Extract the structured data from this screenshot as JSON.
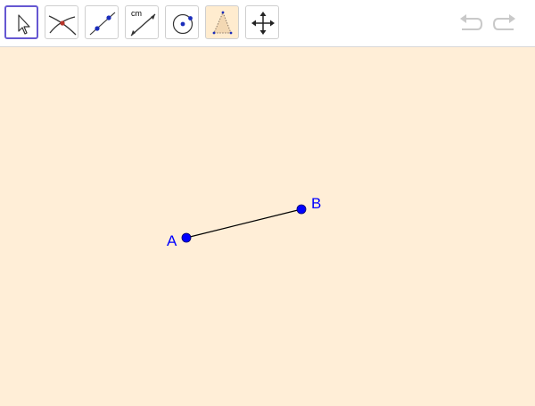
{
  "toolbar": {
    "tools": [
      {
        "name": "move-tool",
        "selected": true
      },
      {
        "name": "intersect-tool"
      },
      {
        "name": "line-tool"
      },
      {
        "name": "distance-tool",
        "label": "cm"
      },
      {
        "name": "circle-tool"
      },
      {
        "name": "polygon-tool",
        "highlighted": true
      },
      {
        "name": "move-graphics-view-tool"
      }
    ],
    "icons": {
      "undo": "undo-icon",
      "redo": "redo-icon"
    },
    "accent_color": "#6557d2"
  },
  "canvas": {
    "background": "#ffeed7",
    "points": [
      {
        "label": "A",
        "color": "#0000ff"
      },
      {
        "label": "B",
        "color": "#0000ff"
      }
    ],
    "segment": {
      "from": "A",
      "to": "B",
      "color": "#000000"
    }
  }
}
